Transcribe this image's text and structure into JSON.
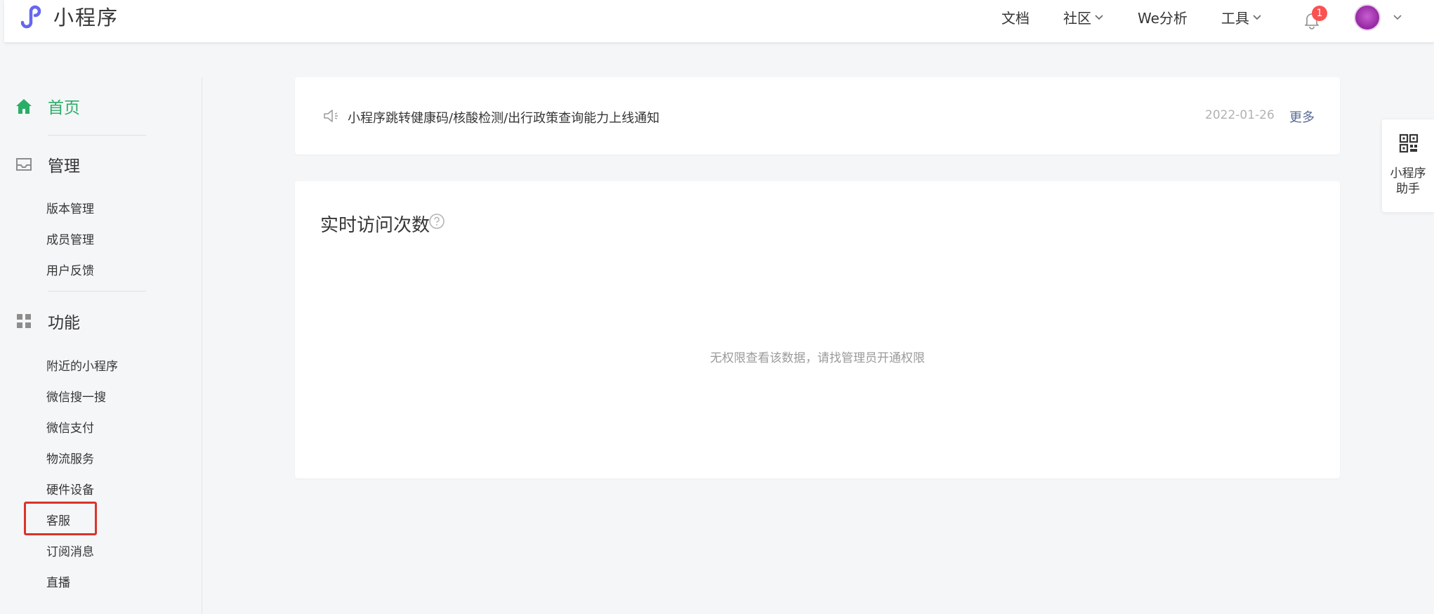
{
  "app": {
    "title": "小程序"
  },
  "topnav": {
    "docs": "文档",
    "community": "社区",
    "analytics": "We分析",
    "tools": "工具",
    "notification_count": "1"
  },
  "sidebar": {
    "home": "首页",
    "manage": {
      "label": "管理",
      "items": [
        "版本管理",
        "成员管理",
        "用户反馈"
      ]
    },
    "features": {
      "label": "功能",
      "items": [
        "附近的小程序",
        "微信搜一搜",
        "微信支付",
        "物流服务",
        "硬件设备",
        "客服",
        "订阅消息",
        "直播"
      ]
    },
    "active_color": "#2aae67"
  },
  "notice": {
    "text": "小程序跳转健康码/核酸检测/出行政策查询能力上线通知",
    "date": "2022-01-26",
    "more": "更多"
  },
  "visits": {
    "title": "实时访问次数",
    "empty_message": "无权限查看该数据，请找管理员开通权限"
  },
  "assistant": {
    "label": "小程序助手"
  },
  "colors": {
    "accent": "#6467f0",
    "link": "#576b95",
    "highlight": "#d9342b"
  }
}
